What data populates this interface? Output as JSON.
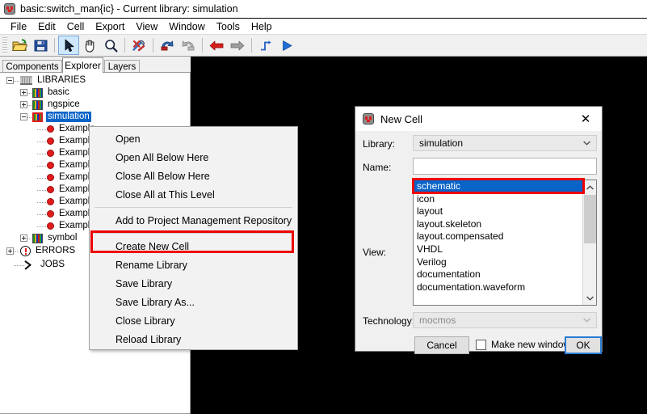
{
  "window": {
    "title": "basic:switch_man{ic} - Current library: simulation",
    "icon": "electric-chip-icon"
  },
  "menubar": {
    "items": [
      "File",
      "Edit",
      "Cell",
      "Export",
      "View",
      "Window",
      "Tools",
      "Help"
    ]
  },
  "toolbar": {
    "buttons": [
      {
        "name": "open-library-icon",
        "title": "Open Library"
      },
      {
        "name": "save-library-icon",
        "title": "Save Library"
      },
      {
        "name": "select-pointer-icon",
        "title": "Select",
        "selected": true
      },
      {
        "name": "pan-hand-icon",
        "title": "Pan"
      },
      {
        "name": "zoom-magnifier-icon",
        "title": "Zoom"
      },
      {
        "name": "preferences-tools-icon",
        "title": "Preferences"
      },
      {
        "name": "undo-icon",
        "title": "Undo"
      },
      {
        "name": "redo-icon",
        "title": "Redo"
      },
      {
        "name": "back-arrow-icon",
        "title": "Go Back"
      },
      {
        "name": "forward-arrow-icon",
        "title": "Go Forward"
      },
      {
        "name": "route-wire-icon",
        "title": "Route"
      },
      {
        "name": "run-simulation-icon",
        "title": "Run"
      }
    ]
  },
  "tabs": [
    {
      "label": "Components",
      "active": false
    },
    {
      "label": "Explorer",
      "active": true
    },
    {
      "label": "Layers",
      "active": false
    }
  ],
  "tree": {
    "nodes": [
      {
        "label": "LIBRARIES",
        "icon": "library-building-icon",
        "depth": 0,
        "expander": "minus",
        "selected": false
      },
      {
        "label": "basic",
        "icon": "books-icon",
        "depth": 1,
        "expander": "plus",
        "selected": false
      },
      {
        "label": "ngspice",
        "icon": "books-icon",
        "depth": 1,
        "expander": "plus",
        "selected": false
      },
      {
        "label": "simulation",
        "icon": "books-icon-highlighted",
        "depth": 1,
        "expander": "minus",
        "selected": true
      },
      {
        "label": "Example",
        "icon": "cell-dot-icon",
        "depth": 2,
        "expander": "none",
        "selected": false
      },
      {
        "label": "Example",
        "icon": "cell-dot-icon",
        "depth": 2,
        "expander": "none",
        "selected": false
      },
      {
        "label": "Example",
        "icon": "cell-dot-icon",
        "depth": 2,
        "expander": "none",
        "selected": false
      },
      {
        "label": "Example",
        "icon": "cell-dot-icon",
        "depth": 2,
        "expander": "none",
        "selected": false
      },
      {
        "label": "Example",
        "icon": "cell-dot-icon",
        "depth": 2,
        "expander": "none",
        "selected": false
      },
      {
        "label": "Example",
        "icon": "cell-dot-icon",
        "depth": 2,
        "expander": "none",
        "selected": false
      },
      {
        "label": "Example",
        "icon": "cell-dot-icon",
        "depth": 2,
        "expander": "none",
        "selected": false
      },
      {
        "label": "Example",
        "icon": "cell-dot-icon",
        "depth": 2,
        "expander": "none",
        "selected": false
      },
      {
        "label": "Example",
        "icon": "cell-dot-icon",
        "depth": 2,
        "expander": "none",
        "selected": false
      },
      {
        "label": "symbol",
        "icon": "books-icon",
        "depth": 1,
        "expander": "plus",
        "selected": false
      },
      {
        "label": "ERRORS",
        "icon": "errors-icon",
        "depth": 0,
        "expander": "plus",
        "selected": false
      },
      {
        "label": "JOBS",
        "icon": "jobs-icon",
        "depth": 0,
        "expander": "none",
        "selected": false
      }
    ]
  },
  "context_menu": {
    "items": [
      {
        "label": "Open",
        "type": "item"
      },
      {
        "label": "Open All Below Here",
        "type": "item"
      },
      {
        "label": "Close All Below Here",
        "type": "item"
      },
      {
        "label": "Close All at This Level",
        "type": "item"
      },
      {
        "label": "",
        "type": "separator"
      },
      {
        "label": "Add to Project Management Repository",
        "type": "item"
      },
      {
        "label": "",
        "type": "separator"
      },
      {
        "label": "Create New Cell",
        "type": "item",
        "highlighted": true
      },
      {
        "label": "Rename Library",
        "type": "item"
      },
      {
        "label": "Save Library",
        "type": "item"
      },
      {
        "label": "Save Library As...",
        "type": "item"
      },
      {
        "label": "Close Library",
        "type": "item"
      },
      {
        "label": "Reload Library",
        "type": "item"
      }
    ],
    "highlight_color": "#ee0000"
  },
  "dialog": {
    "title": "New Cell",
    "close_label": "✕",
    "library": {
      "label": "Library:",
      "value": "simulation"
    },
    "name": {
      "label": "Name:",
      "value": "",
      "placeholder": ""
    },
    "view": {
      "label": "View:",
      "selected": "schematic",
      "options": [
        "schematic",
        "icon",
        "layout",
        "layout.skeleton",
        "layout.compensated",
        "VHDL",
        "Verilog",
        "documentation",
        "documentation.waveform"
      ],
      "highlight_color": "#ee0000"
    },
    "technology": {
      "label": "Technology:",
      "value": "mocmos",
      "disabled": true
    },
    "cancel_label": "Cancel",
    "ok_label": "OK",
    "checkbox_label": "Make new window",
    "checkbox_checked": false
  },
  "colors": {
    "canvas": "#000000",
    "selection": "#0a64c8",
    "highlight_red": "#ee0000",
    "dialog_bg": "#f0f0f0",
    "toolbar_bg": "#f0f0f0"
  }
}
